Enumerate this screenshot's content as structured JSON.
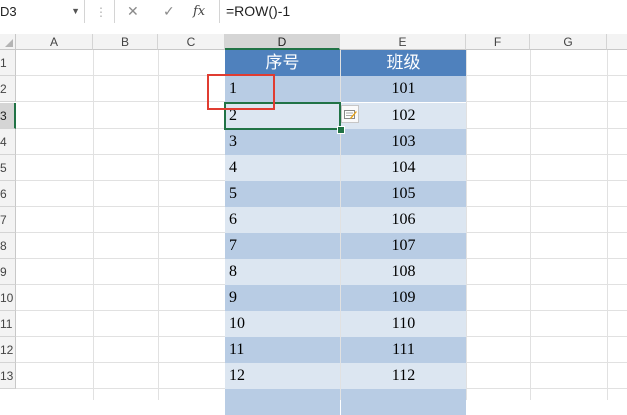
{
  "formula_bar": {
    "name_box": "D3",
    "cancel_glyph": "✕",
    "enter_glyph": "✓",
    "fx_label": "fx",
    "formula": "=ROW()-1"
  },
  "columns": [
    "A",
    "B",
    "C",
    "D",
    "E",
    "F",
    "G"
  ],
  "rows": [
    "1",
    "2",
    "3",
    "4",
    "5",
    "6",
    "7",
    "8",
    "9",
    "10",
    "11",
    "12",
    "13"
  ],
  "table": {
    "headers": [
      "序号",
      "班级"
    ],
    "data": [
      [
        "1",
        "101"
      ],
      [
        "2",
        "102"
      ],
      [
        "3",
        "103"
      ],
      [
        "4",
        "104"
      ],
      [
        "5",
        "105"
      ],
      [
        "6",
        "106"
      ],
      [
        "7",
        "107"
      ],
      [
        "8",
        "108"
      ],
      [
        "9",
        "109"
      ],
      [
        "10",
        "110"
      ],
      [
        "11",
        "111"
      ],
      [
        "12",
        "112"
      ],
      [
        "",
        ""
      ]
    ]
  },
  "colors": {
    "header_fill": "#4f81bd",
    "band_dark": "#b8cce4",
    "band_light": "#dce6f1",
    "active_border": "#217346",
    "highlight_box": "#e03c31"
  },
  "icons": {
    "smart_tag": "autofill-options-icon",
    "dropdown": "chevron-down-icon"
  }
}
